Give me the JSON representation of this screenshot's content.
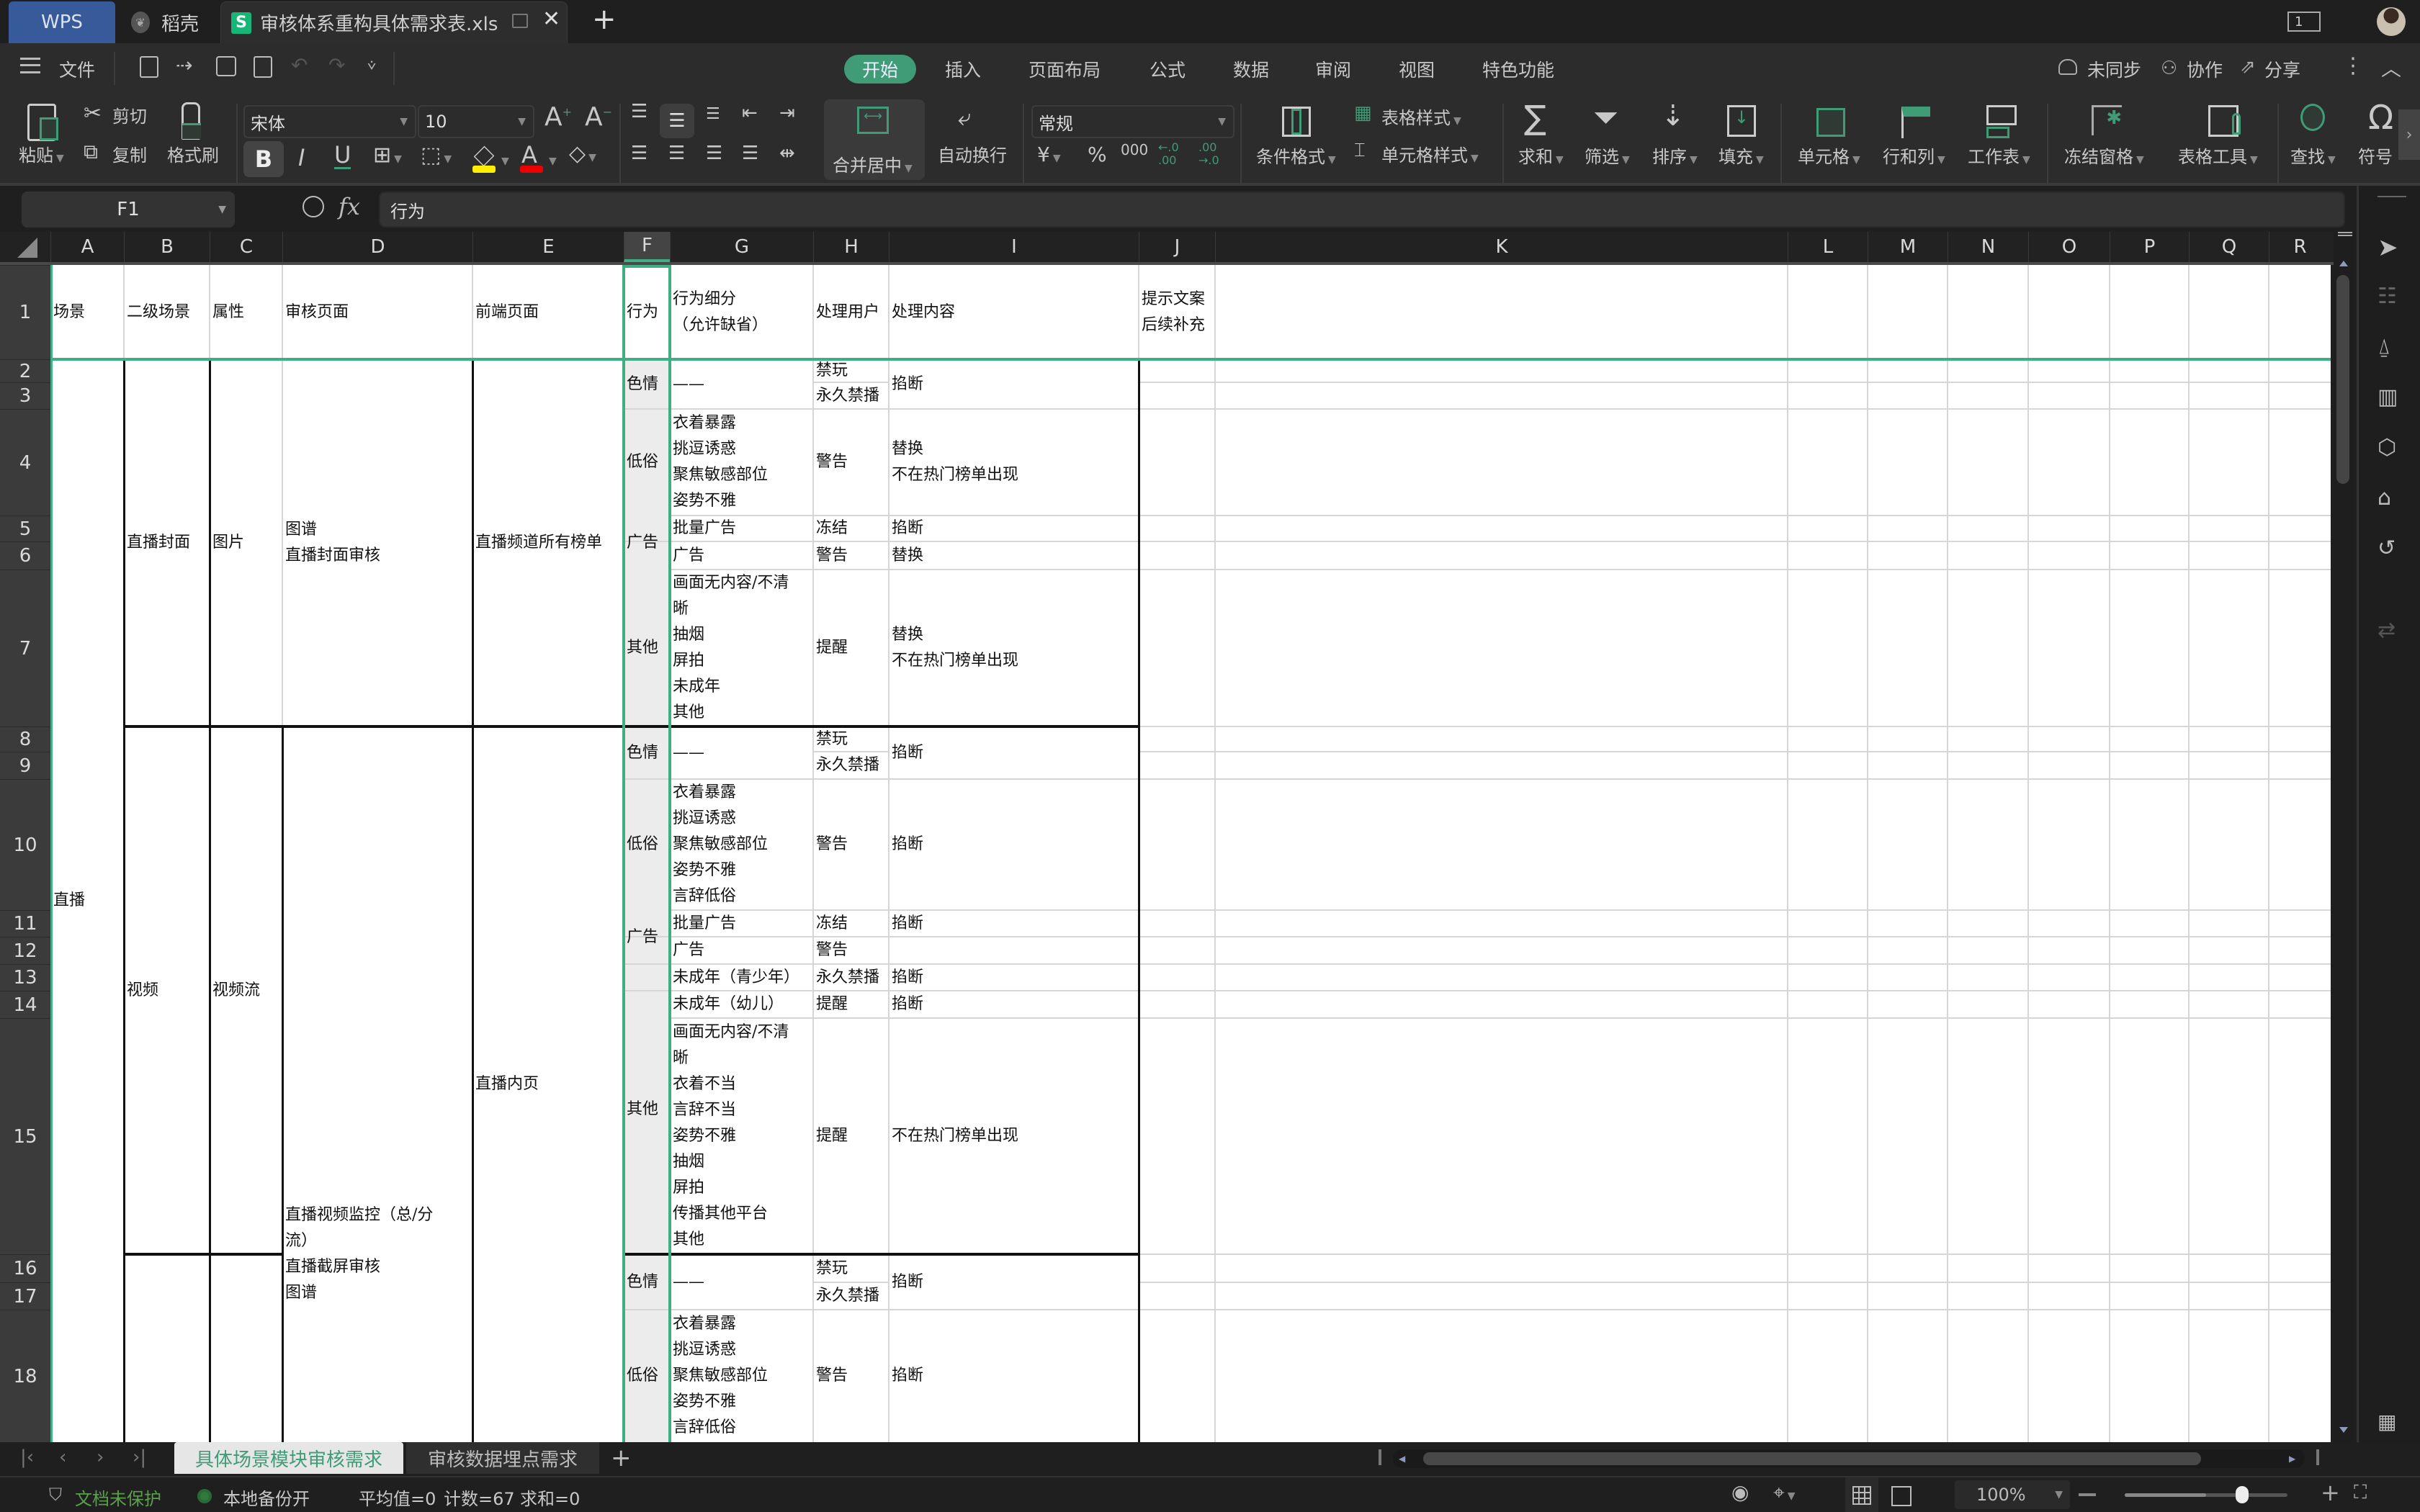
{
  "titlebar": {
    "app_tab": "WPS",
    "tabs": [
      {
        "label": "稻壳",
        "icon": "docer-icon"
      },
      {
        "label": "审核体系重构具体需求表.xls",
        "icon": "spreadsheet-icon",
        "active": true
      }
    ],
    "new_tab": "+",
    "close": "✕",
    "page_indicator": "1"
  },
  "menubar": {
    "file_label": "文件",
    "tabs": [
      "开始",
      "插入",
      "页面布局",
      "公式",
      "数据",
      "审阅",
      "视图",
      "特色功能"
    ],
    "active_tab": "开始",
    "right": {
      "sync": "未同步",
      "collab": "协作",
      "share": "分享"
    }
  },
  "ribbon": {
    "clipboard": {
      "paste": "粘贴",
      "cut": "剪切",
      "copy": "复制",
      "format_painter": "格式刷"
    },
    "font": {
      "name": "宋体",
      "size": "10",
      "bold": "B",
      "italic": "I",
      "underline": "U"
    },
    "alignment": {
      "merge_center": "合并居中",
      "wrap_text": "自动换行"
    },
    "number": {
      "format": "常规",
      "currency": "¥",
      "percent": "%",
      "thousands": "000",
      "inc_decimal": "←.0 .00",
      "dec_decimal": ".00 →.0"
    },
    "styles": {
      "conditional_format": "条件格式",
      "table_style": "表格样式",
      "cell_style": "单元格样式"
    },
    "editing": {
      "sum": "求和",
      "filter": "筛选",
      "sort": "排序",
      "fill": "填充"
    },
    "cells": {
      "cell": "单元格",
      "row_col": "行和列",
      "worksheet": "工作表"
    },
    "view": {
      "freeze": "冻结窗格",
      "table_tools": "表格工具"
    },
    "find": {
      "find": "查找",
      "symbol": "符号"
    }
  },
  "formulabar": {
    "name_box": "F1",
    "fx": "fx",
    "value": "行为"
  },
  "columns": [
    "A",
    "B",
    "C",
    "D",
    "E",
    "F",
    "G",
    "H",
    "I",
    "J",
    "K",
    "L",
    "M",
    "N",
    "O",
    "P",
    "Q",
    "R"
  ],
  "selected_column": "F",
  "rows": [
    "1",
    "2",
    "3",
    "4",
    "5",
    "6",
    "7",
    "8",
    "9",
    "10",
    "11",
    "12",
    "13",
    "14",
    "15",
    "16",
    "17",
    "18"
  ],
  "sheet": {
    "header": {
      "A": "场景",
      "B": "二级场景",
      "C": "属性",
      "D": "审核页面",
      "E": "前端页面",
      "F": "行为",
      "G": "行为细分\n（允许缺省）",
      "H": "处理用户",
      "I": "处理内容",
      "J": "提示文案\n后续补充"
    },
    "A_merged": "直播",
    "block1": {
      "B": "直播封面",
      "C": "图片",
      "D": "图谱\n直播封面审核",
      "E": "直播频道所有榜单",
      "F": [
        "色情",
        "低俗",
        "广告",
        "其他"
      ],
      "rows": [
        {
          "G": "——",
          "H": "禁玩",
          "I": "掐断"
        },
        {
          "H": "永久禁播"
        },
        {
          "G": "衣着暴露\n挑逗诱惑\n聚焦敏感部位\n姿势不雅",
          "H": "警告",
          "I": "替换\n不在热门榜单出现"
        },
        {
          "G": "批量广告",
          "H": "冻结",
          "I": "掐断"
        },
        {
          "G": "广告",
          "H": "警告",
          "I": "替换"
        },
        {
          "G": "画面无内容/不清\n晰\n抽烟\n屏拍\n未成年\n其他",
          "H": "提醒",
          "I": "替换\n不在热门榜单出现"
        }
      ]
    },
    "block2": {
      "B": "视频",
      "C": "视频流",
      "D": "直播视频监控（总/分\n流）",
      "E": "直播内页",
      "F": [
        "色情",
        "低俗",
        "广告",
        "其他"
      ],
      "rows": [
        {
          "G": "——",
          "H": "禁玩",
          "I": "掐断"
        },
        {
          "H": "永久禁播"
        },
        {
          "G": "衣着暴露\n挑逗诱惑\n聚焦敏感部位\n姿势不雅\n言辞低俗",
          "H": "警告",
          "I": "掐断"
        },
        {
          "G": "批量广告",
          "H": "冻结",
          "I": "掐断"
        },
        {
          "G": "广告",
          "H": "警告",
          "I": ""
        },
        {
          "G": "未成年（青少年）",
          "H": "永久禁播",
          "I": "掐断"
        },
        {
          "G": "未成年（幼儿）",
          "H": "提醒",
          "I": "掐断"
        },
        {
          "G": "画面无内容/不清\n晰\n衣着不当\n言辞不当\n姿势不雅\n抽烟\n屏拍\n传播其他平台\n其他",
          "H": "提醒",
          "I": "不在热门榜单出现"
        }
      ]
    },
    "block3": {
      "D": "直播截屏审核\n图谱",
      "F": [
        "色情",
        "低俗"
      ],
      "rows": [
        {
          "G": "——",
          "H": "禁玩",
          "I": "掐断"
        },
        {
          "H": "永久禁播"
        },
        {
          "G": "衣着暴露\n挑逗诱惑\n聚焦敏感部位\n姿势不雅\n言辞低俗",
          "H": "警告",
          "I": "掐断"
        }
      ]
    }
  },
  "sheet_tabs": {
    "tabs": [
      "具体场景模块审核需求",
      "审核数据埋点需求"
    ],
    "active": "具体场景模块审核需求",
    "add": "+"
  },
  "statusbar": {
    "protect": "文档未保护",
    "backup": "本地备份开",
    "avg": "平均值=0",
    "count": "计数=67",
    "sum": "求和=0",
    "zoom": "100%",
    "zoom_level": 0.5
  },
  "colors": {
    "accent": "#3f9c76",
    "selection": "#3fae84",
    "wps_tab": "#375a9b",
    "spreadsheet_badge": "#16b676",
    "status_green": "#5aa04a"
  }
}
